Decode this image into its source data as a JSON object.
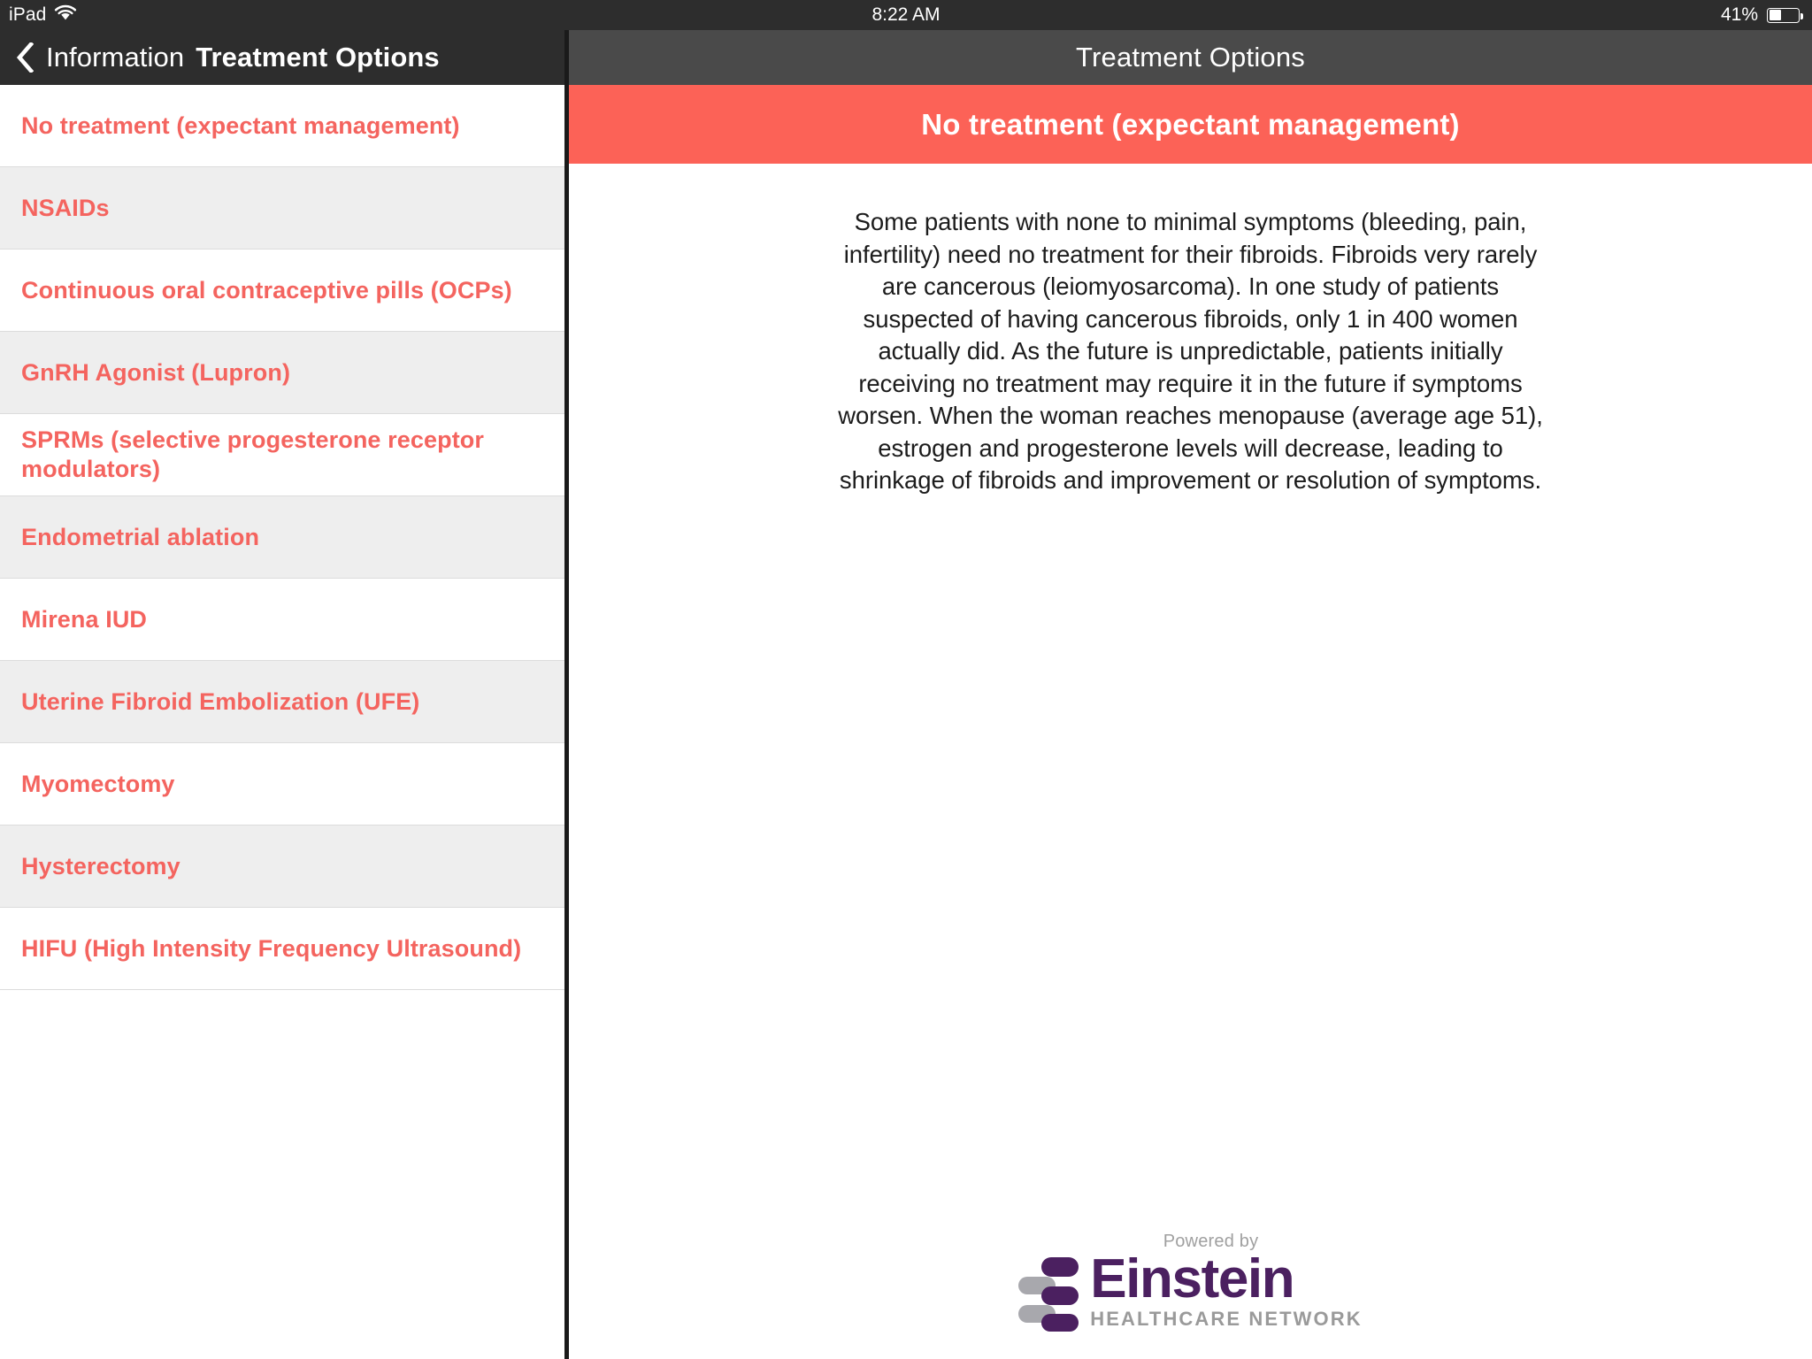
{
  "status_bar": {
    "device": "iPad",
    "wifi_icon": "wifi-icon",
    "time": "8:22 AM",
    "battery_percent": "41%",
    "battery_level": 41
  },
  "left_nav": {
    "back_icon": "chevron-left-icon",
    "back_label": "Information",
    "title": "Treatment Options"
  },
  "right_nav": {
    "title": "Treatment Options"
  },
  "sidebar": {
    "items": [
      {
        "label": "No treatment (expectant management)",
        "selected": true
      },
      {
        "label": "NSAIDs",
        "selected": false
      },
      {
        "label": "Continuous oral contraceptive pills (OCPs)",
        "selected": false
      },
      {
        "label": "GnRH Agonist (Lupron)",
        "selected": false
      },
      {
        "label": "SPRMs (selective progesterone receptor modulators)",
        "selected": false
      },
      {
        "label": "Endometrial ablation",
        "selected": false
      },
      {
        "label": "Mirena IUD",
        "selected": false
      },
      {
        "label": "Uterine Fibroid Embolization (UFE)",
        "selected": false
      },
      {
        "label": "Myomectomy",
        "selected": false
      },
      {
        "label": "Hysterectomy",
        "selected": false
      },
      {
        "label": "HIFU (High Intensity Frequency Ultrasound)",
        "selected": false
      }
    ]
  },
  "content": {
    "banner_title": "No treatment (expectant management)",
    "body": "Some patients with none to minimal symptoms (bleeding, pain, infertility) need no treatment for their fibroids. Fibroids very rarely are cancerous (leiomyosarcoma). In one study of patients suspected of having cancerous fibroids, only 1 in 400 women actually did. As the future is unpredictable, patients initially receiving no treatment may require it in the future if symptoms worsen. When the woman reaches menopause (average age 51), estrogen and progesterone levels will decrease, leading to shrinkage of fibroids and improvement or resolution of symptoms."
  },
  "footer": {
    "powered_by": "Powered by",
    "brand_name": "Einstein",
    "brand_tagline": "HEALTHCARE NETWORK",
    "logo_icon": "einstein-logo-icon"
  },
  "colors": {
    "accent_red": "#fc6257",
    "list_text_red": "#f4645f",
    "navbar_dark": "#2d2d2d",
    "header_gray": "#4a4a4a",
    "row_alt_gray": "#eeeeee",
    "brand_purple": "#4b2060",
    "brand_gray": "#9a9a9a"
  }
}
